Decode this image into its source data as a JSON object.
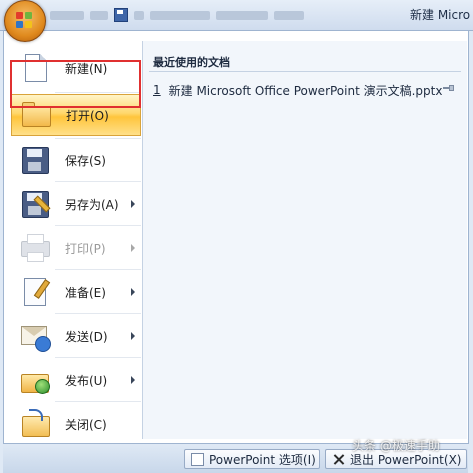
{
  "window": {
    "title": "新建 Micro"
  },
  "left_menu": {
    "items": [
      {
        "label": "新建(N)",
        "icon": "new-document-icon",
        "submenu": false,
        "disabled": false
      },
      {
        "label": "打开(O)",
        "icon": "open-folder-icon",
        "submenu": false,
        "disabled": false,
        "selected": true
      },
      {
        "label": "保存(S)",
        "icon": "save-icon",
        "submenu": false,
        "disabled": false
      },
      {
        "label": "另存为(A)",
        "icon": "save-as-icon",
        "submenu": true,
        "disabled": false
      },
      {
        "label": "打印(P)",
        "icon": "print-icon",
        "submenu": true,
        "disabled": true
      },
      {
        "label": "准备(E)",
        "icon": "prepare-icon",
        "submenu": true,
        "disabled": false
      },
      {
        "label": "发送(D)",
        "icon": "send-icon",
        "submenu": true,
        "disabled": false
      },
      {
        "label": "发布(U)",
        "icon": "publish-icon",
        "submenu": true,
        "disabled": false
      },
      {
        "label": "关闭(C)",
        "icon": "close-folder-icon",
        "submenu": false,
        "disabled": false
      }
    ]
  },
  "recent": {
    "heading": "最近使用的文档",
    "items": [
      {
        "num": "1",
        "name": "新建 Microsoft Office PowerPoint 演示文稿.pptx"
      }
    ]
  },
  "bottom": {
    "options_label": "PowerPoint 选项(I)",
    "exit_label": "退出 PowerPoint(X)"
  },
  "watermark": "头条 @极速手助",
  "colors": {
    "selected_highlight": "#ffc53c",
    "annotation_box": "#e03030",
    "office_button": "#e08a1e"
  }
}
